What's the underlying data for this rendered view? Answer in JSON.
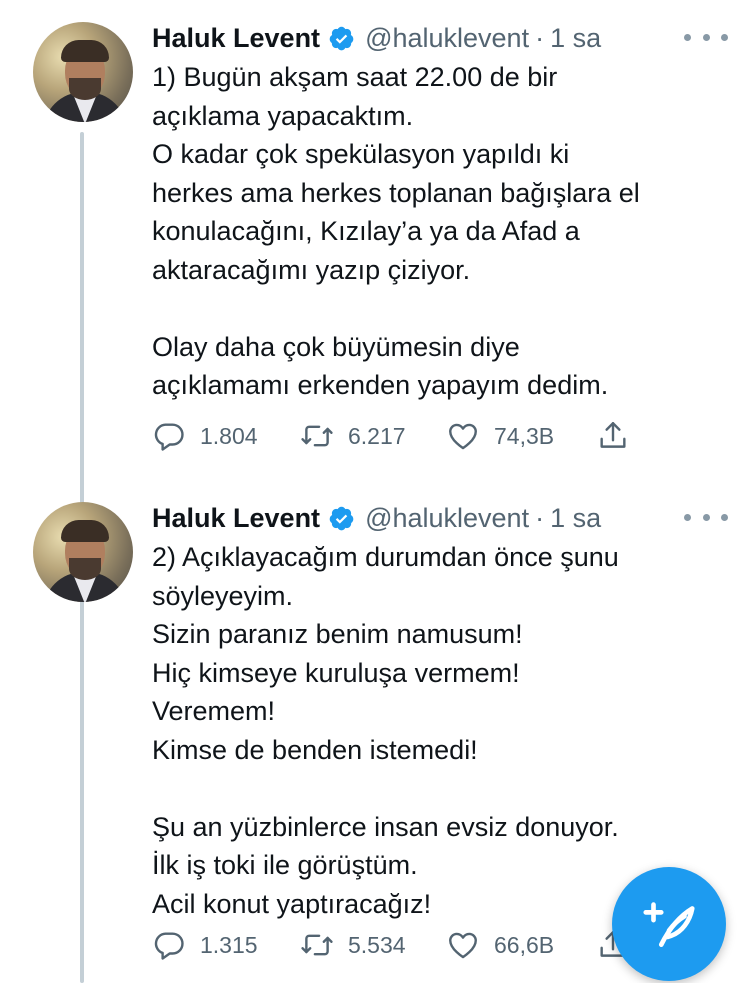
{
  "tweets": [
    {
      "author": {
        "name": "Haluk Levent",
        "handle": "@haluklevent",
        "verified": true
      },
      "time": "1 sa",
      "text": "1) Bugün akşam saat 22.00 de bir\naçıklama yapacaktım.\nO kadar çok spekülasyon yapıldı ki\nherkes ama herkes toplanan bağışlara el\nkonulacağını, Kızılay’a ya da Afad a\naktaracağımı yazıp çiziyor.\n\nOlay daha çok büyümesin diye\naçıklamamı erkenden yapayım dedim.",
      "stats": {
        "replies": "1.804",
        "retweets": "6.217",
        "likes": "74,3B"
      }
    },
    {
      "author": {
        "name": "Haluk Levent",
        "handle": "@haluklevent",
        "verified": true
      },
      "time": "1 sa",
      "text": "2) Açıklayacağım durumdan önce şunu\nsöyleyeyim.\nSizin paranız benim namusum!\nHiç kimseye kuruluşa vermem!\nVeremem!\nKimse de benden istemedi!\n\nŞu an yüzbinlerce insan evsiz donuyor.\nİlk iş toki ile görüştüm.\nAcil konut yaptıracağız!",
      "stats": {
        "replies": "1.315",
        "retweets": "5.534",
        "likes": "66,6B"
      }
    }
  ],
  "separator": "·",
  "colors": {
    "accent": "#1d9bf0",
    "secondary_text": "#536471",
    "thread_line": "#c4cfd6"
  },
  "icons": {
    "reply": "reply-icon",
    "retweet": "retweet-icon",
    "like": "heart-icon",
    "share": "share-icon",
    "compose": "compose-tweet-icon",
    "verified": "verified-badge-icon",
    "more": "more-options-icon"
  }
}
